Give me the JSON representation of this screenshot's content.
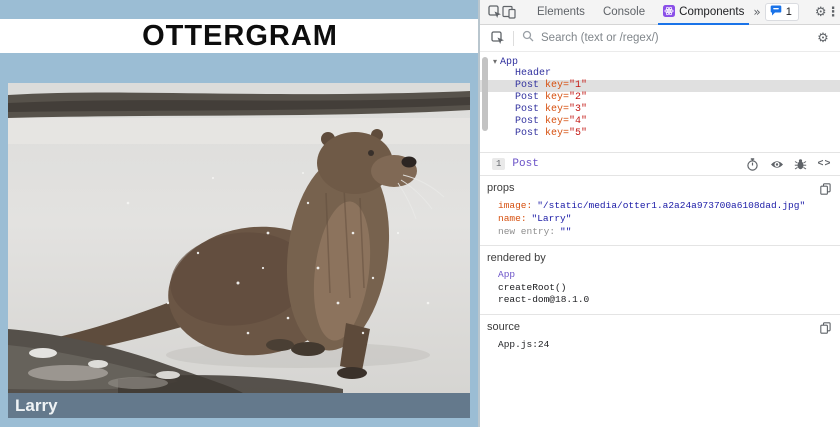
{
  "page": {
    "title": "OTTERGRAM",
    "photo_caption": "Larry"
  },
  "colors": {
    "page_bg": "#9BBDD4",
    "caption_bg": "#64798C",
    "devtools_accent": "#1A73E8",
    "component_name": "#32329F",
    "component_link": "#6A51C7",
    "attr_orange": "#D6500F",
    "attr_value_red": "#C41A16",
    "string_blue": "#1A1AA6",
    "react_icon": "#8A4FE8"
  },
  "devtools": {
    "tabs": [
      {
        "label": "Elements"
      },
      {
        "label": "Console"
      },
      {
        "label": "Components"
      }
    ],
    "more_tabs_glyph": "»",
    "notification_count": "1",
    "settings_glyph": "⚙",
    "menu_glyph": "⋮",
    "close_glyph": "×",
    "search": {
      "placeholder": "Search (text or /regex/)"
    },
    "tree": {
      "disclosure_glyph": "▾",
      "root": "App",
      "items": [
        {
          "name": "Header"
        },
        {
          "name": "Post",
          "attr": "key=",
          "value": "\"1\""
        },
        {
          "name": "Post",
          "attr": "key=",
          "value": "\"2\""
        },
        {
          "name": "Post",
          "attr": "key=",
          "value": "\"3\""
        },
        {
          "name": "Post",
          "attr": "key=",
          "value": "\"4\""
        },
        {
          "name": "Post",
          "attr": "key=",
          "value": "\"5\""
        }
      ]
    },
    "inspected": {
      "badge": "1",
      "name": "Post",
      "code_glyph": "<>",
      "props": {
        "label": "props",
        "rows": [
          {
            "key": "image",
            "value": "\"/static/media/otter1.a2a24a973700a6108dad.jpg\""
          },
          {
            "key": "name",
            "value": "\"Larry\""
          },
          {
            "key": "new entry",
            "value": "\"\""
          }
        ]
      },
      "rendered_by": {
        "label": "rendered by",
        "items": [
          "App",
          "createRoot()",
          "react-dom@18.1.0"
        ]
      },
      "source": {
        "label": "source",
        "value": "App.js:24"
      }
    }
  }
}
